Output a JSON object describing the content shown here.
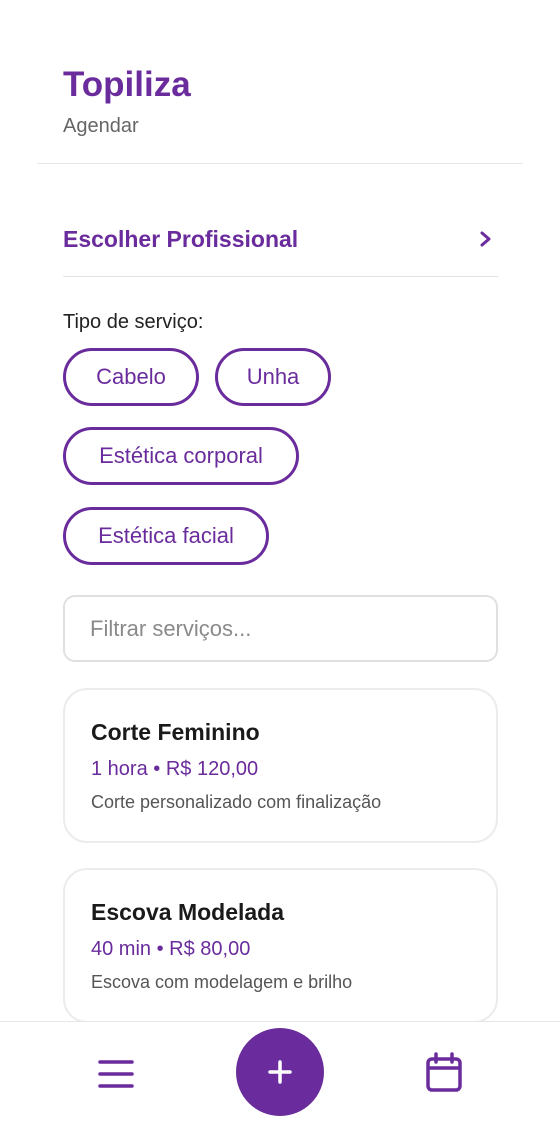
{
  "header": {
    "app_title": "Topiliza",
    "subtitle": "Agendar"
  },
  "professional": {
    "label": "Escolher Profissional",
    "chevron": "›"
  },
  "service_type": {
    "label": "Tipo de serviço:",
    "chips": [
      {
        "label": "Cabelo"
      },
      {
        "label": "Unha"
      },
      {
        "label": "Estética corporal"
      },
      {
        "label": "Estética facial"
      }
    ]
  },
  "filter": {
    "placeholder": "Filtrar serviços...",
    "value": ""
  },
  "services": [
    {
      "title": "Corte Feminino",
      "meta": "1 hora • R$ 120,00",
      "description": "Corte personalizado com finalização"
    },
    {
      "title": "Escova Modelada",
      "meta": "40 min • R$ 80,00",
      "description": "Escova com modelagem e brilho"
    }
  ],
  "bottom_nav": {
    "icons": [
      "menu-icon",
      "plus-icon",
      "calendar-icon"
    ]
  },
  "colors": {
    "accent": "#6a2c9c",
    "text": "#222222",
    "muted": "#666666",
    "border": "#e6e6e6"
  }
}
